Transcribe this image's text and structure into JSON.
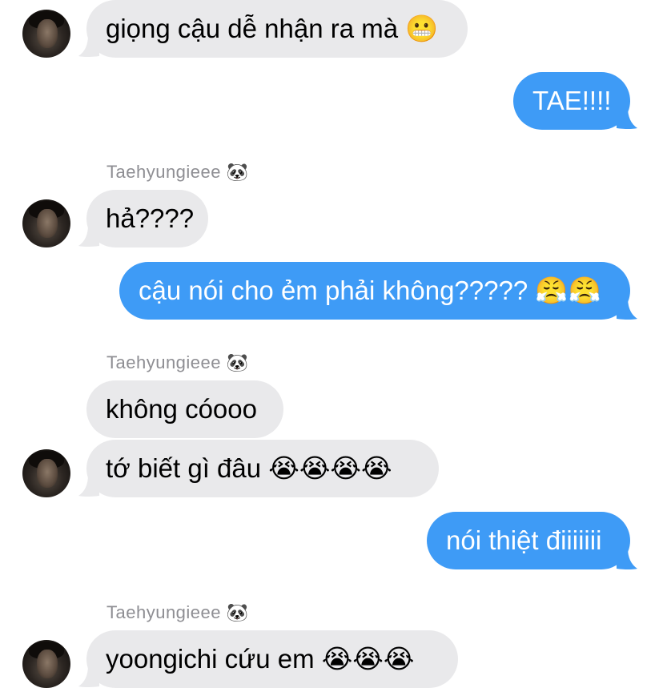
{
  "conversation": {
    "sender_name": "Taehyungieee 🐼",
    "messages": [
      {
        "direction": "incoming",
        "text": "giọng cậu dễ nhận ra mà 😬"
      },
      {
        "direction": "outgoing",
        "text": "TAE!!!!"
      },
      {
        "direction": "incoming",
        "text": "hả????"
      },
      {
        "direction": "outgoing",
        "text": "cậu nói cho ẻm phải không????? 😤😤"
      },
      {
        "direction": "incoming",
        "text": "không cóooo"
      },
      {
        "direction": "incoming",
        "text": "tớ biết gì đâu 😭😭😭😭"
      },
      {
        "direction": "outgoing",
        "text": "nói thiệt điiiiiii"
      },
      {
        "direction": "incoming",
        "text": "yoongichi cứu em 😭😭😭"
      }
    ]
  },
  "colors": {
    "incoming_bubble": "#e9e9eb",
    "outgoing_bubble": "#3e9bf6",
    "sender_label": "#8e8e93"
  }
}
